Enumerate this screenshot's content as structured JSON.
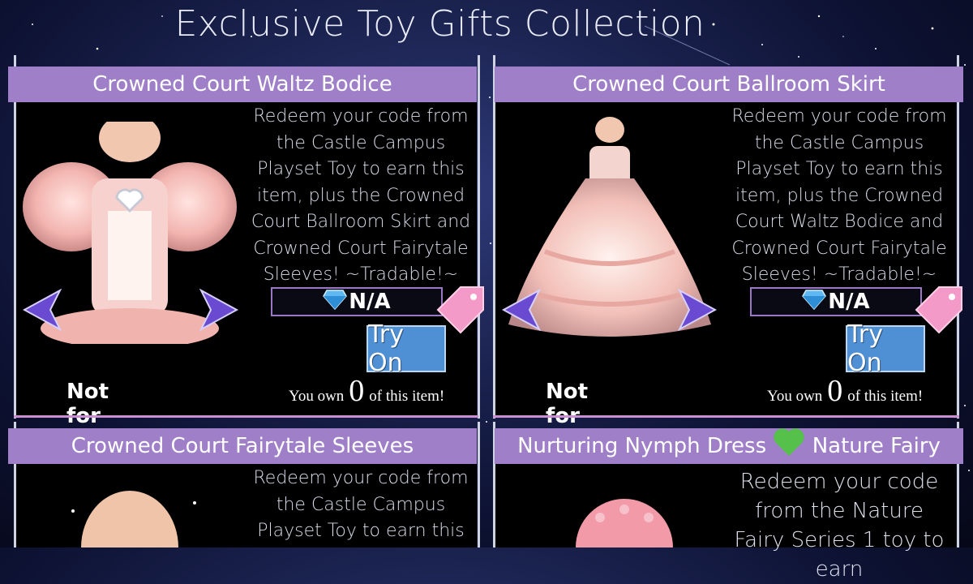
{
  "page_title": "Exclusive Toy Gifts Collection",
  "cards": [
    {
      "name": "Crowned Court Waltz Bodice",
      "description": "Redeem your code from the Castle Campus Playset Toy to earn this item, plus the Crowned Court Ballroom Skirt and Crowned Court Fairytale Sleeves! ~Tradable!~",
      "price": "N/A",
      "try_on_label": "Try On",
      "sale_status": "Not for Sale",
      "own_prefix": "You own",
      "own_count": "0",
      "own_suffix": "of this item!"
    },
    {
      "name": "Crowned Court Ballroom Skirt",
      "description": "Redeem your code from the Castle Campus Playset Toy to earn this item, plus the Crowned Court Waltz Bodice and Crowned Court Fairytale Sleeves! ~Tradable!~",
      "price": "N/A",
      "try_on_label": "Try On",
      "sale_status": "Not for Sale",
      "own_prefix": "You own",
      "own_count": "0",
      "own_suffix": "of this item!"
    },
    {
      "name": "Crowned Court Fairytale Sleeves",
      "description": "Redeem your code from the Castle Campus Playset Toy to earn this"
    },
    {
      "name_part1": "Nurturing Nymph Dress",
      "name_part2": "Nature Fairy",
      "description": "Redeem your code from the Nature Fairy Series 1 toy to earn"
    }
  ],
  "icons": {
    "gem": "diamond-gem-icon",
    "tag": "price-tag-icon",
    "prev": "arrow-left-icon",
    "next": "arrow-right-icon",
    "heart": "green-heart-icon"
  },
  "colors": {
    "header": "#9e7fc8",
    "try_on": "#4f8fd4",
    "tag": "#f49ac8",
    "heart": "#55c04a"
  }
}
